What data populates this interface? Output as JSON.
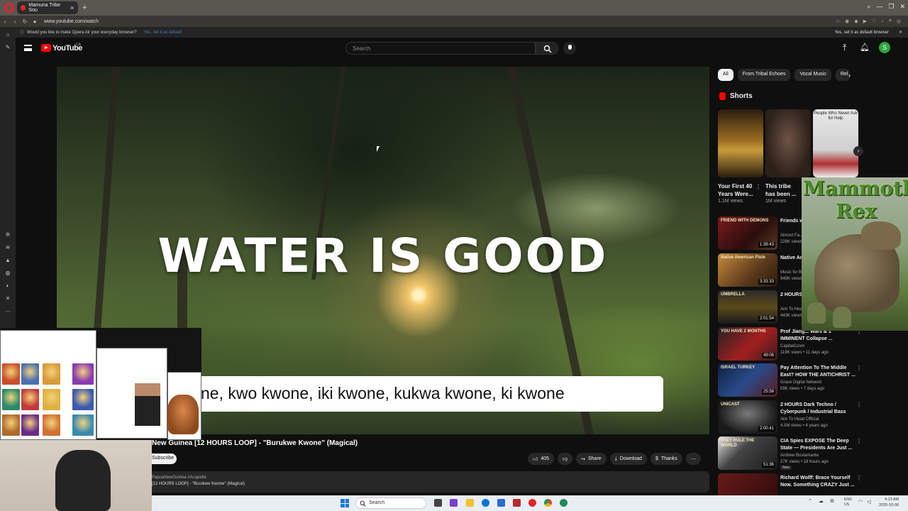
{
  "browser": {
    "tab_title": "Mamuna Tribe Sou",
    "url": "www.youtube.com/watch",
    "notification": "Would you like to make Opera Air your everyday browser?",
    "notification_link": "Yes, set it as default",
    "notification_right": "Yes, set it as default browser"
  },
  "youtube": {
    "logo_text": "YouTube",
    "region": "CA",
    "search_placeholder": "Search",
    "avatar_letter": "S"
  },
  "video": {
    "overlay_text": "WATER IS GOOD",
    "caption": "ne, kwo kwone, iki kwone, kukwa kwone, ki kwone",
    "title": "New Guinea [12 HOURS LOOP] - \"Burukwe Kwone\" (Magical)",
    "subscribe": "Subscribe",
    "likes": "405",
    "share": "Share",
    "download": "Download",
    "thanks": "Thanks",
    "description_tags": "PapuaNewGuinea #Acapella",
    "description_line": "[12 HOURS LOOP] - \"Burukwe Kwone\" (Magical)"
  },
  "chips": [
    "All",
    "From Tribal Echoes",
    "Vocal Music",
    "Rel"
  ],
  "shorts": {
    "heading": "Shorts",
    "items": [
      {
        "title": "Your First 40 Years Were...",
        "views": "1.1M views"
      },
      {
        "title": "This tribe has been ...",
        "views": "1M views"
      },
      {
        "title": "",
        "views": "",
        "overlay": "People Who Never Ask for Help"
      }
    ]
  },
  "recommendations": [
    {
      "title": "Friends wi... Atheist W...",
      "channel": "Almost Fa...",
      "views": "228K views",
      "duration": "1:39:43",
      "thumb_text": "FRIEND WITH DEMONS"
    },
    {
      "title": "Native Am... Remove A...",
      "channel": "Music for B...",
      "views": "949K views",
      "duration": "3:33:33",
      "thumb_text": "Native American Flute"
    },
    {
      "title": "2 HOURS ... / Industria...",
      "channel": "Aim To Hea...",
      "views": "443K views",
      "duration": "2:01:54",
      "thumb_text": "UMBRELLA"
    },
    {
      "title": "Prof Jiang... Wars & 1 IMMINENT Collapse ...",
      "channel": "CapitalCosm",
      "views": "119K views • 11 days ago",
      "duration": "49:06",
      "thumb_text": "YOU HAVE 2 MONTHS"
    },
    {
      "title": "Pay Attention To The Middle East? HOW THE ANTICHRIST ...",
      "channel": "Grace Digital Network",
      "views": "59K views • 7 days ago",
      "duration": "25:58",
      "thumb_text": "ISRAEL TURKEY"
    },
    {
      "title": "2 HOURS Dark Techno / Cyberpunk / Industrial Bass Mi...",
      "channel": "Aim To Head Official",
      "views": "4.5M views • 4 years ago",
      "duration": "2:00:41",
      "thumb_text": "UNICAST"
    },
    {
      "title": "CIA Spies EXPOSE The Deep State — Presidents Are Just ...",
      "channel": "Andrew Bustamante",
      "views": "27K views • 18 hours ago",
      "duration": "51:36",
      "thumb_text": "THEY RULE THE WORLD",
      "badge": "New"
    },
    {
      "title": "Richard Wolff: Brace Yourself Now. Something CRAZY Just ...",
      "channel": "",
      "views": "",
      "duration": "",
      "thumb_text": ""
    }
  ],
  "overlay_ad": {
    "title": "Mammoth Rex"
  },
  "taskbar": {
    "search": "Search",
    "lang": "ENG",
    "region": "US",
    "time": "4:13 AM",
    "date": "2025-10-06"
  },
  "colors": {
    "youtube_red": "#ff0000",
    "background": "#0f0f0f",
    "chip_bg": "#272727",
    "avatar_green": "#2ba640",
    "opera_red": "#e0262e"
  }
}
